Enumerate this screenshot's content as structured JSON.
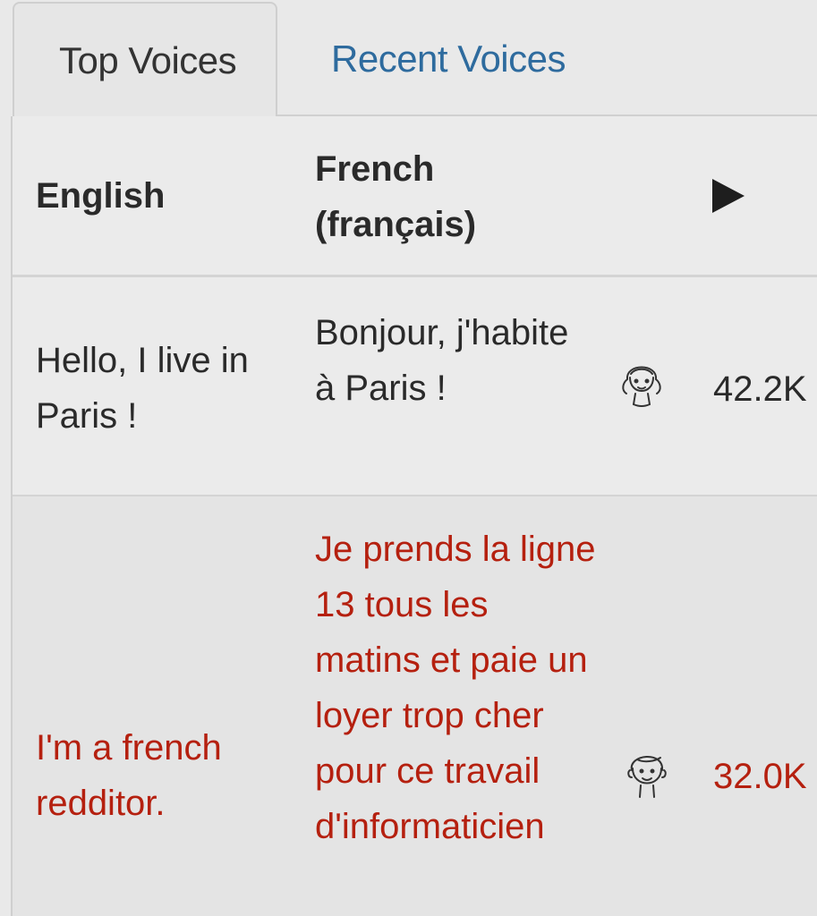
{
  "tabs": {
    "active": "Top Voices",
    "inactive": "Recent Voices"
  },
  "table": {
    "headers": {
      "english": "English",
      "french_line1": "French",
      "french_line2": "(français)",
      "play_icon": "play-icon"
    },
    "rows": [
      {
        "english": "Hello, I live in Paris !",
        "french": "Bonjour, j'habite à Paris !",
        "avatar_icon": "female-avatar-icon",
        "count": "42.2K",
        "color": "#2a2a2a"
      },
      {
        "english": "I'm a french redditor.",
        "french": "Je prends la ligne 13 tous les matins et paie un loyer trop cher pour ce travail d'informaticien",
        "avatar_icon": "male-avatar-icon",
        "count": "32.0K",
        "color": "#b5200f"
      }
    ]
  },
  "colors": {
    "background": "#e9e9e9",
    "link_tab": "#2e6b9e",
    "highlight_text": "#b5200f",
    "text": "#2a2a2a"
  }
}
